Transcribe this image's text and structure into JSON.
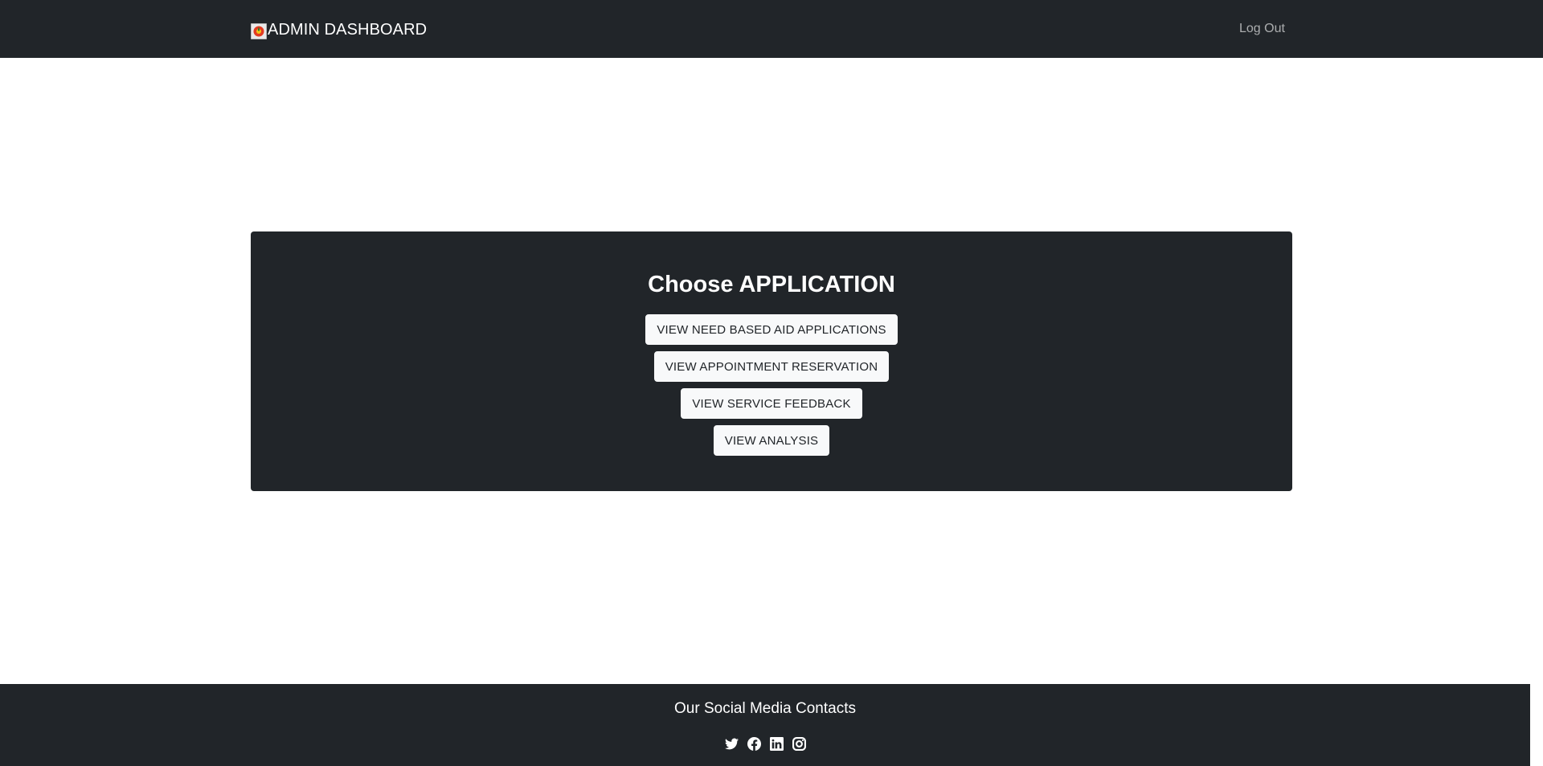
{
  "navbar": {
    "brand_label": "ADMIN DASHBOARD",
    "logo_icon": "admin-logo-icon",
    "logout_label": "Log Out",
    "background": "#212529"
  },
  "main": {
    "panel_title": "Choose APPLICATION",
    "buttons": [
      {
        "label": "VIEW NEED BASED AID APPLICATIONS"
      },
      {
        "label": "VIEW APPOINTMENT RESERVATION"
      },
      {
        "label": "VIEW SERVICE FEEDBACK"
      },
      {
        "label": "VIEW ANALYSIS"
      }
    ]
  },
  "footer": {
    "title": "Our Social Media Contacts",
    "social_icons": [
      "twitter-icon",
      "facebook-icon",
      "linkedin-icon",
      "instagram-icon"
    ]
  },
  "colors": {
    "dark": "#212529",
    "button_bg": "#f8f9fa",
    "muted_link": "#9a9da0"
  }
}
